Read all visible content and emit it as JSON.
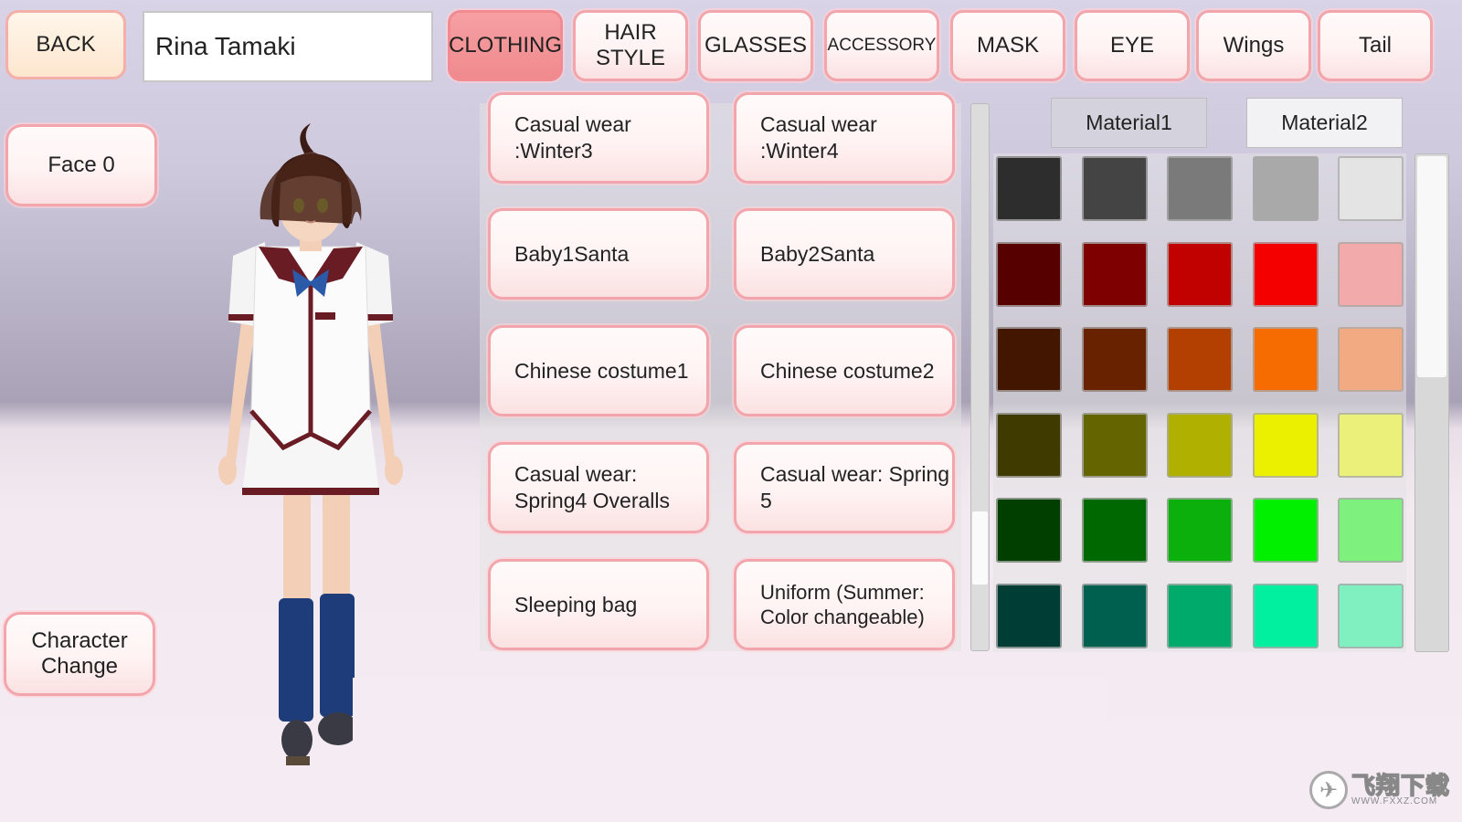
{
  "header": {
    "back_label": "BACK",
    "character_name": "Rina Tamaki"
  },
  "tabs": [
    {
      "label": "CLOTHING",
      "active": true
    },
    {
      "label": "HAIR STYLE",
      "active": false
    },
    {
      "label": "GLASSES",
      "active": false
    },
    {
      "label": "ACCESSORY",
      "active": false
    },
    {
      "label": "MASK",
      "active": false
    },
    {
      "label": "EYE",
      "active": false
    },
    {
      "label": "Wings",
      "active": false
    },
    {
      "label": "Tail",
      "active": false
    }
  ],
  "left_panel": {
    "face_label": "Face 0",
    "character_change_label": "Character Change"
  },
  "clothing_items": [
    "Casual wear :Winter3",
    "Casual wear :Winter4",
    "Baby1Santa",
    "Baby2Santa",
    "Chinese costume1",
    "Chinese costume2",
    "Casual wear: Spring4 Overalls",
    "Casual wear: Spring 5",
    "Sleeping bag",
    "Uniform (Summer: Color changeable)"
  ],
  "materials": {
    "material1_label": "Material1",
    "material2_label": "Material2",
    "selected": "Material1"
  },
  "palette_colors": [
    [
      "#2d2d2d",
      "#444444",
      "#7a7a7a",
      "#a9a9a9",
      "#e4e4e4"
    ],
    [
      "#560000",
      "#7f0000",
      "#c10000",
      "#f40000",
      "#f2aaaa"
    ],
    [
      "#421600",
      "#682200",
      "#b44000",
      "#f66c00",
      "#f2aa82"
    ],
    [
      "#3f3b00",
      "#646400",
      "#b0b000",
      "#eaf000",
      "#eaf07a"
    ],
    [
      "#003f00",
      "#006800",
      "#0cb00c",
      "#00f000",
      "#7ef07e"
    ],
    [
      "#003d34",
      "#006050",
      "#00aa6a",
      "#00f0a0",
      "#80f0c0"
    ]
  ],
  "list_scroll_fraction": 0.86,
  "palette_scroll_fraction": 0.0,
  "watermark": {
    "main": "飞翔下载",
    "sub": "WWW.FXXZ.COM"
  }
}
